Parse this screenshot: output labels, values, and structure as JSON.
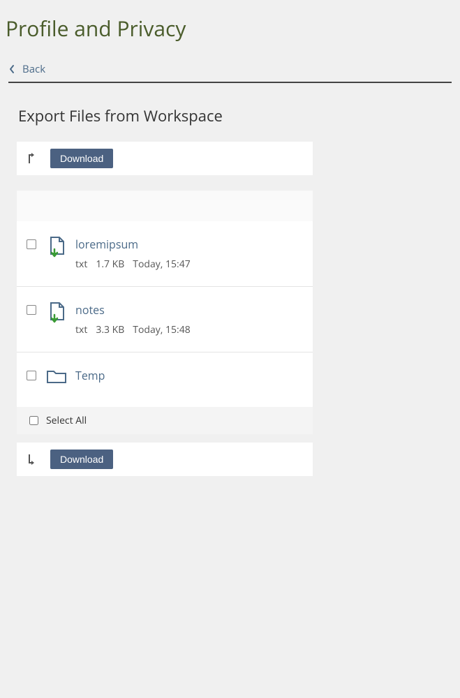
{
  "page": {
    "title": "Profile and Privacy",
    "back_label": "Back",
    "section_title": "Export Files from Workspace"
  },
  "toolbar": {
    "download_label": "Download"
  },
  "files": [
    {
      "name": "loremipsum",
      "kind": "file",
      "ext": "txt",
      "size": "1.7 KB",
      "modified": "Today, 15:47"
    },
    {
      "name": "notes",
      "kind": "file",
      "ext": "txt",
      "size": "3.3 KB",
      "modified": "Today, 15:48"
    },
    {
      "name": "Temp",
      "kind": "folder"
    }
  ],
  "select_all_label": "Select All"
}
